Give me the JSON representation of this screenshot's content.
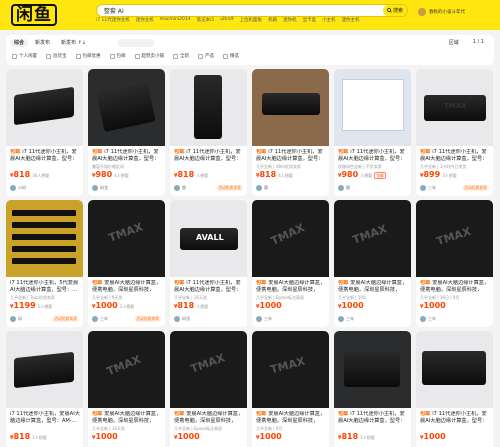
{
  "app": {
    "logo_text": "闲鱼"
  },
  "search": {
    "value": "整套 AI",
    "button_label": "搜索"
  },
  "suggestions": [
    "i7 11代迷你主机",
    "迷你主机",
    "macmini2014",
    "笔记本i5",
    "ultra9",
    "上位机面板",
    "机箱",
    "迷你机",
    "显卡盒",
    "小主机",
    "迷你主机"
  ],
  "user": {
    "name": "春秋的小奋斗年代",
    "menu": "卖闲置"
  },
  "filters": {
    "sort": [
      {
        "label": "综合",
        "active": true
      },
      {
        "label": "新发布",
        "active": false
      },
      {
        "label": "新发布 ↑↓",
        "active": false
      }
    ],
    "price_label": "价格",
    "price_sep": "-",
    "region_label": "区域",
    "page": "1 / 1",
    "checkboxes": [
      "个人闲置",
      "验货宝",
      "包邮优惠",
      "包邮",
      "超赞卖小铺",
      "全新",
      "严选",
      "精选"
    ]
  },
  "products": [
    {
      "title": "i7 11代迷你小主机，爱晨AI大脑边缘计算盒，型号：AM-...",
      "xy": true,
      "meta": "",
      "price": "818",
      "want": "34人想要",
      "badges": [],
      "seller": "小码",
      "seller_badge": ""
    },
    {
      "title": "i7 11代迷你小主机，爱晨AI大脑边缘计算盒，型号：AM-...",
      "xy": true,
      "meta": "兼容不同价格区间",
      "price": "980",
      "want": "4人想要",
      "badges": [],
      "seller": "码龙",
      "seller_badge": ""
    },
    {
      "title": "i7 11代迷你小主机，爱晨AI大脑边缘计算盒，型号：AM...",
      "xy": true,
      "meta": "",
      "price": "818",
      "want": "人想要",
      "badges": [],
      "seller": "晨",
      "seller_badge": "活动优质卖家"
    },
    {
      "title": "i7 11代迷你小主机，爱晨AI大脑边缘计算盒，型号：AM-...",
      "xy": true,
      "meta": "几乎全新 | 48m优质卖家",
      "price": "818",
      "want": "4人想要",
      "badges": [],
      "seller": "晨",
      "seller_badge": ""
    },
    {
      "title": "i7 11代迷你小主机，爱晨AI大脑边缘计算盒，型号：AM-...",
      "xy": true,
      "meta": "纹路成色全新 | 不负卖家",
      "price": "980",
      "want": "人想要",
      "badges": [
        "包邮"
      ],
      "seller": "晨",
      "seller_badge": ""
    },
    {
      "title": "i7 11代迷你小主机，爱晨AI大脑边缘计算盒，型号：AM-...",
      "xy": true,
      "meta": "几乎全新 | 1小时内已发货",
      "price": "899",
      "want": "3人想要",
      "badges": [],
      "seller": "三年",
      "seller_badge": "活动优质卖家"
    },
    {
      "title": "i7 11代迷你小主机，5代爱晨AI大脑边缘计算盒，型号：...",
      "xy": false,
      "meta": "几乎全新 | Tsup优质卖家",
      "price": "1199",
      "want": "1人想要",
      "badges": [],
      "seller": "闲",
      "seller_badge": "活动优质卖家"
    },
    {
      "title": "爱晨AI大脑边缘计算盒，便携电脑，深圳星辰科技，110...",
      "xy": true,
      "meta": "几乎全新 | 9天发",
      "price": "1000",
      "want": "1人想要",
      "badges": [],
      "seller": "三年",
      "seller_badge": "活动优质卖家"
    },
    {
      "title": "i7 11代迷你小主机，爱晨AI大脑边缘计算盒，型号：AM-...",
      "xy": true,
      "meta": "几乎全新 | 16天发",
      "price": "818",
      "want": "人想要",
      "badges": [],
      "seller": "码龙",
      "seller_badge": ""
    },
    {
      "title": "爱晨AI大脑边缘计算盒，便携电脑，深圳星辰科技，11...",
      "xy": true,
      "meta": "几乎全新 | Epson标注表现",
      "price": "1000",
      "want": "",
      "badges": [],
      "seller": "三年",
      "seller_badge": ""
    },
    {
      "title": "爱晨AI大脑边缘计算盒，便携电脑，深圳星辰科技，11...",
      "xy": true,
      "meta": "几乎全新 | 100",
      "price": "1000",
      "want": "",
      "badges": [],
      "seller": "三年",
      "seller_badge": ""
    },
    {
      "title": "爱晨AI大脑边缘计算盒，便携电脑，深圳星辰科技，11...",
      "xy": true,
      "meta": "几乎全新 | 16日 | 9月",
      "price": "1000",
      "want": "",
      "badges": [],
      "seller": "三年",
      "seller_badge": ""
    },
    {
      "title": "i7 11代迷你小主机，爱晨AI大脑边缘计算盒，型号：AM-...",
      "xy": false,
      "meta": "",
      "price": "818",
      "want": "1人想要",
      "badges": [],
      "seller": "",
      "seller_badge": ""
    },
    {
      "title": "爱晨AI大脑边缘计算盒，便携电脑，深圳星辰科技，11...",
      "xy": true,
      "meta": "几乎全新 | 16天发",
      "price": "1000",
      "want": "",
      "badges": [],
      "seller": "",
      "seller_badge": ""
    },
    {
      "title": "爱晨AI大脑边缘计算盒，便携电脑，深圳星辰科技，11...",
      "xy": true,
      "meta": "几乎全新 | Epson标注表现",
      "price": "1000",
      "want": "",
      "badges": [],
      "seller": "",
      "seller_badge": ""
    },
    {
      "title": "爱晨AI大脑边缘计算盒，便携电脑，深圳星辰科技，11...",
      "xy": true,
      "meta": "几乎全新 | 9月",
      "price": "1000",
      "want": "",
      "badges": [],
      "seller": "",
      "seller_badge": ""
    },
    {
      "title": "i7 11代迷你小主机，爱晨AI大脑边缘计算盒，型号：AM-...",
      "xy": true,
      "meta": "",
      "price": "818",
      "want": "1人想要",
      "badges": [],
      "seller": "",
      "seller_badge": ""
    },
    {
      "title": "i7 11代迷你小主机，爱晨AI大脑边缘计算盒，型号：AM-...",
      "xy": true,
      "meta": "",
      "price": "1000",
      "want": "",
      "badges": [],
      "seller": "",
      "seller_badge": ""
    }
  ],
  "colors": {
    "brand": "#ffe60f",
    "price": "#ff4400"
  }
}
